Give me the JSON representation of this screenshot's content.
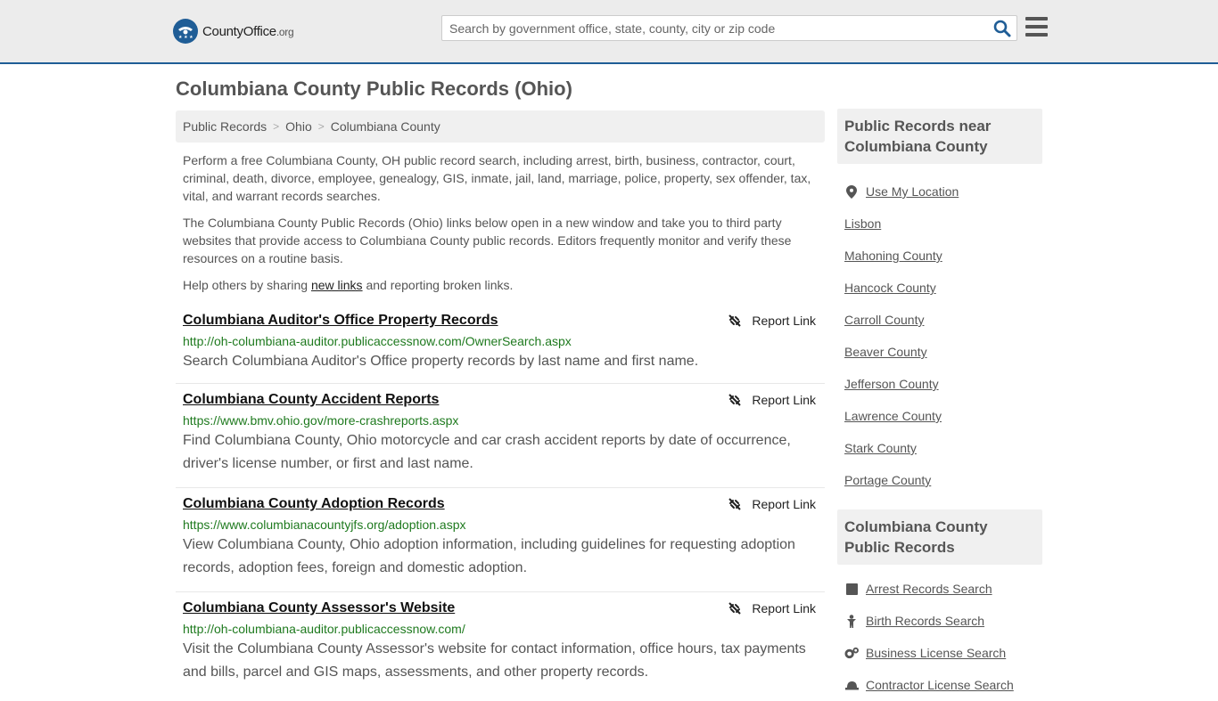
{
  "header": {
    "logo_text": "CountyOffice",
    "logo_suffix": ".org",
    "search_placeholder": "Search by government office, state, county, city or zip code"
  },
  "page_title": "Columbiana County Public Records (Ohio)",
  "breadcrumb": [
    "Public Records",
    "Ohio",
    "Columbiana County"
  ],
  "intro": {
    "p1": "Perform a free Columbiana County, OH public record search, including arrest, birth, business, contractor, court, criminal, death, divorce, employee, genealogy, GIS, inmate, jail, land, marriage, police, property, sex offender, tax, vital, and warrant records searches.",
    "p2": "The Columbiana County Public Records (Ohio) links below open in a new window and take you to third party websites that provide access to Columbiana County public records. Editors frequently monitor and verify these resources on a routine basis.",
    "p3_before": "Help others by sharing ",
    "p3_link": "new links",
    "p3_after": " and reporting broken links."
  },
  "report_label": "Report Link",
  "records": [
    {
      "title": "Columbiana Auditor's Office Property Records",
      "url": "http://oh-columbiana-auditor.publicaccessnow.com/OwnerSearch.aspx",
      "desc": "Search Columbiana Auditor's Office property records by last name and first name."
    },
    {
      "title": "Columbiana County Accident Reports",
      "url": "https://www.bmv.ohio.gov/more-crashreports.aspx",
      "desc": "Find Columbiana County, Ohio motorcycle and car crash accident reports by date of occurrence, driver's license number, or first and last name."
    },
    {
      "title": "Columbiana County Adoption Records",
      "url": "https://www.columbianacountyjfs.org/adoption.aspx",
      "desc": "View Columbiana County, Ohio adoption information, including guidelines for requesting adoption records, adoption fees, foreign and domestic adoption."
    },
    {
      "title": "Columbiana County Assessor's Website",
      "url": "http://oh-columbiana-auditor.publicaccessnow.com/",
      "desc": "Visit the Columbiana County Assessor's website for contact information, office hours, tax payments and bills, parcel and GIS maps, assessments, and other property records."
    }
  ],
  "sidebar_near": {
    "heading": "Public Records near Columbiana County",
    "use_location": "Use My Location",
    "items": [
      "Lisbon",
      "Mahoning County",
      "Hancock County",
      "Carroll County",
      "Beaver County",
      "Jefferson County",
      "Lawrence County",
      "Stark County",
      "Portage County"
    ]
  },
  "sidebar_records": {
    "heading": "Columbiana County Public Records",
    "items": [
      {
        "label": "Arrest Records Search",
        "icon": "square-icon"
      },
      {
        "label": "Birth Records Search",
        "icon": "baby-icon"
      },
      {
        "label": "Business License Search",
        "icon": "gears-icon"
      },
      {
        "label": "Contractor License Search",
        "icon": "hardhat-icon"
      }
    ]
  },
  "colors": {
    "brand": "#1f5d96",
    "url_green": "#1f7a1f",
    "topbar_bg": "#ececec"
  }
}
